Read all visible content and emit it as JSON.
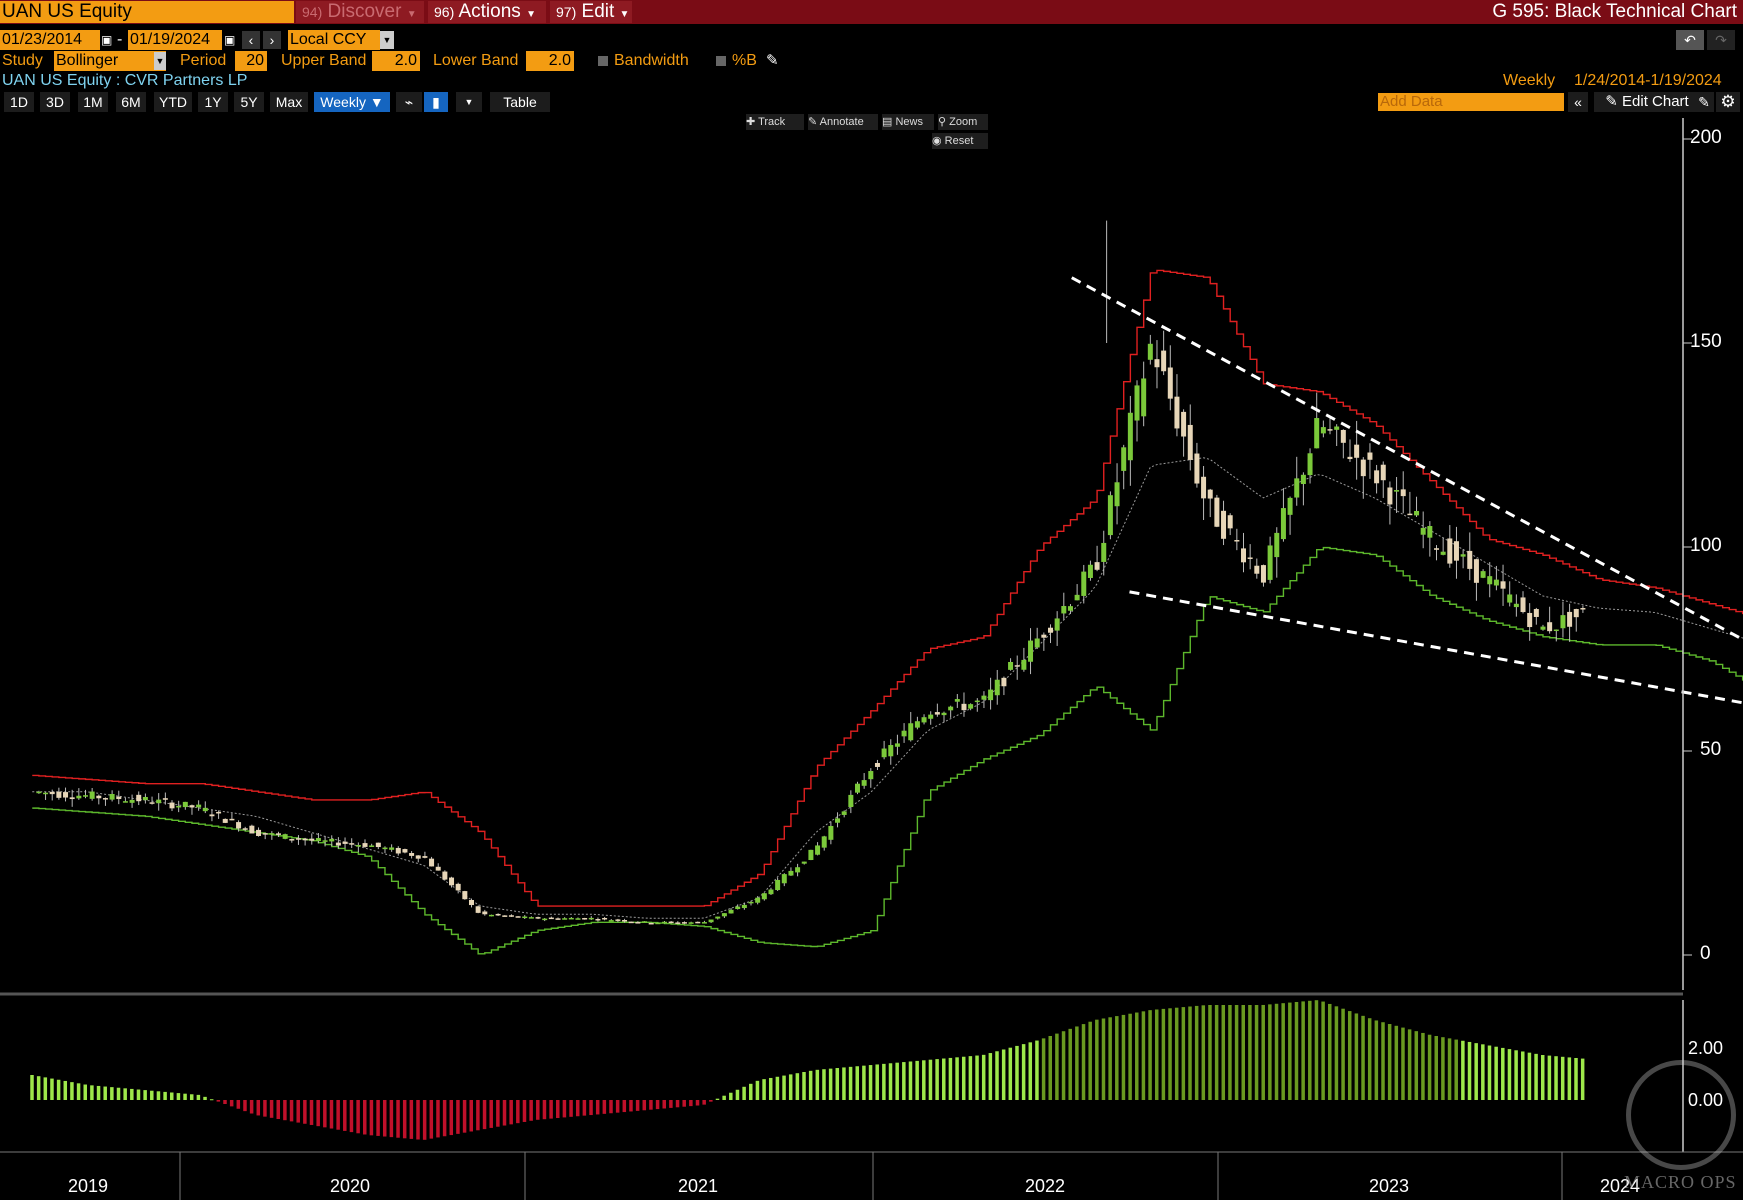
{
  "header": {
    "ticker": "UAN US Equity",
    "menu": [
      {
        "num": "94)",
        "label": "Discover",
        "disabled": true
      },
      {
        "num": "96)",
        "label": "Actions",
        "disabled": false
      },
      {
        "num": "97)",
        "label": "Edit",
        "disabled": false
      }
    ],
    "function_title": "G 595: Black Technical Chart"
  },
  "range": {
    "start": "01/23/2014",
    "dash": "-",
    "end": "01/19/2024",
    "currency": "Local CCY"
  },
  "study": {
    "study_label": "Study",
    "study_value": "Bollinger",
    "period_label": "Period",
    "period_value": "20",
    "upper_label": "Upper Band",
    "upper_value": "2.0",
    "lower_label": "Lower Band",
    "lower_value": "2.0",
    "bandwidth_label": "Bandwidth",
    "pctb_label": "%B"
  },
  "security": {
    "name": "UAN US Equity : CVR Partners LP",
    "frequency": "Weekly",
    "date_span": "1/24/2014-1/19/2024"
  },
  "toolbar": {
    "timeframes": [
      "1D",
      "3D",
      "1M",
      "6M",
      "YTD",
      "1Y",
      "5Y",
      "Max"
    ],
    "frequency_select": "Weekly ▼",
    "table_label": "Table",
    "add_data_placeholder": "Add Data",
    "edit_chart_label": "Edit Chart"
  },
  "chart_tools": {
    "track": "Track",
    "annotate": "Annotate",
    "news": "News",
    "zoom": "Zoom",
    "reset": "Reset"
  },
  "watermark": "MACRO OPS",
  "colors": {
    "upper_band": "#e02020",
    "lower_band": "#5db82c",
    "middle_band": "#9a9a9a",
    "candle_up": "#7bc93a",
    "candle_down": "#e7d6b8",
    "trendline": "#ffffff",
    "pctb_positive_light": "#9ee84a",
    "pctb_positive_dark": "#6a9a20",
    "pctb_negative": "#c0102a",
    "header_bar": "#7a0c15",
    "accent": "#f39c12"
  },
  "chart_data": {
    "type": "candlestick",
    "frequency": "weekly",
    "x_ticks": [
      "2019",
      "2020",
      "2021",
      "2022",
      "2023",
      "2024"
    ],
    "y_ticks": [
      "200",
      "150",
      "100",
      "50",
      "0"
    ],
    "ylim": [
      -10,
      205
    ],
    "x": [
      "2018-11",
      "2019-01",
      "2019-03",
      "2019-05",
      "2019-07",
      "2019-09",
      "2019-11",
      "2020-01",
      "2020-03",
      "2020-05",
      "2020-07",
      "2020-09",
      "2020-11",
      "2021-01",
      "2021-03",
      "2021-05",
      "2021-07",
      "2021-09",
      "2021-11",
      "2021-12",
      "2022-01",
      "2022-03",
      "2022-05",
      "2022-07",
      "2022-09",
      "2022-11",
      "2023-01",
      "2023-03",
      "2023-05",
      "2023-07",
      "2023-09",
      "2023-11",
      "2024-01"
    ],
    "close": [
      40,
      39,
      38,
      36,
      30,
      28,
      27,
      24,
      10,
      9,
      9,
      8,
      8,
      14,
      26,
      46,
      60,
      62,
      78,
      95,
      150,
      110,
      93,
      130,
      118,
      102,
      92,
      80,
      85,
      90,
      78,
      66,
      68
    ],
    "upper_band": [
      44,
      43,
      42,
      42,
      40,
      38,
      38,
      40,
      30,
      12,
      12,
      12,
      12,
      20,
      46,
      60,
      75,
      78,
      100,
      112,
      168,
      166,
      140,
      138,
      130,
      116,
      102,
      98,
      92,
      90,
      86,
      82,
      88
    ],
    "middle_band": [
      40,
      40,
      38,
      36,
      34,
      30,
      26,
      22,
      12,
      10,
      10,
      9,
      9,
      14,
      30,
      40,
      55,
      62,
      76,
      90,
      120,
      122,
      112,
      118,
      112,
      104,
      96,
      88,
      85,
      84,
      80,
      76,
      74
    ],
    "lower_band": [
      36,
      35,
      34,
      32,
      30,
      28,
      24,
      10,
      0,
      6,
      8,
      8,
      7,
      3,
      2,
      6,
      40,
      48,
      54,
      66,
      55,
      88,
      84,
      100,
      98,
      88,
      82,
      78,
      76,
      76,
      72,
      64,
      63
    ],
    "pctb_y_ticks": [
      "2.00",
      "0.00"
    ],
    "pctb": [
      1.0,
      0.6,
      0.4,
      0.2,
      -0.6,
      -1.0,
      -1.4,
      -1.6,
      -1.2,
      -0.8,
      -0.6,
      -0.4,
      -0.2,
      0.8,
      1.2,
      1.4,
      1.6,
      1.8,
      2.4,
      3.2,
      3.6,
      3.8,
      3.8,
      4.0,
      3.2,
      2.6,
      2.2,
      1.8,
      1.6,
      1.4,
      1.2,
      0.8,
      -0.2
    ],
    "trendlines": [
      {
        "from": [
          "2021-11",
          166
        ],
        "to": [
          "2024-02",
          63
        ]
      },
      {
        "from": [
          "2022-01",
          89
        ],
        "to": [
          "2024-02",
          57
        ]
      }
    ]
  }
}
